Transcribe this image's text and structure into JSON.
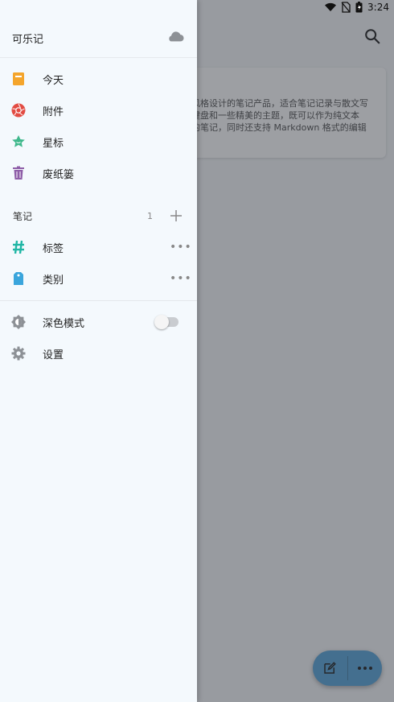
{
  "status_bar": {
    "time": "3:24",
    "icons": [
      "wifi-icon",
      "no-sim-icon",
      "battery-icon"
    ]
  },
  "background": {
    "card_text": "风格设计的笔记产品，适合笔记记录与散文写\n键盘和一些精美的主题，既可以作为纯文本\n的笔记，同时还支持 Markdown 格式的编辑",
    "search_icon": "search-icon"
  },
  "drawer": {
    "app_name": "可乐记",
    "cloud_icon": "cloud-icon",
    "menu": [
      {
        "label": "今天",
        "icon": "calendar-icon",
        "color": "#f4a52c"
      },
      {
        "label": "附件",
        "icon": "aperture-icon",
        "color": "#e24c43"
      },
      {
        "label": "星标",
        "icon": "star-icon",
        "color": "#3fb88c"
      },
      {
        "label": "废纸篓",
        "icon": "trash-icon",
        "color": "#8e5ea8"
      }
    ],
    "notes_section": {
      "label": "笔记",
      "count": "1"
    },
    "note_items": [
      {
        "label": "标签",
        "icon": "hashtag-icon",
        "color": "#20b6a5"
      },
      {
        "label": "类别",
        "icon": "tag-icon",
        "color": "#3aa5dc"
      }
    ],
    "settings": [
      {
        "label": "深色模式",
        "icon": "dark-mode-icon",
        "toggle": false
      },
      {
        "label": "设置",
        "icon": "gear-icon"
      }
    ]
  },
  "fab": {
    "left_icon": "edit-icon",
    "right_icon": "more-icon",
    "color": "#4d9fd6"
  }
}
